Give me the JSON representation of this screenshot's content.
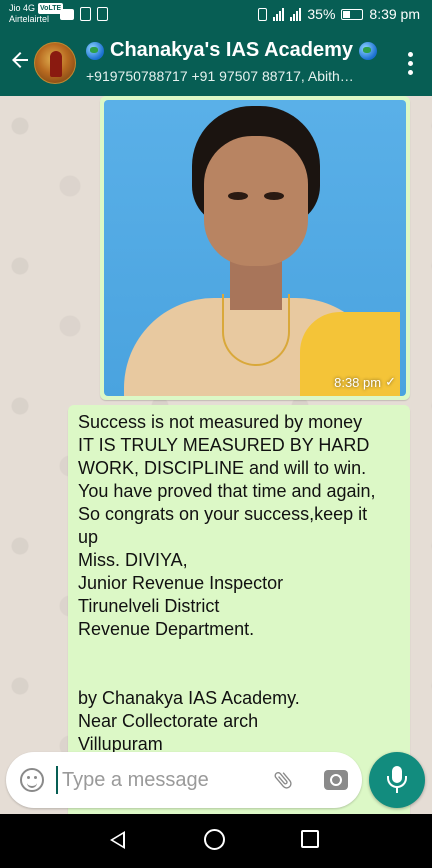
{
  "status_bar": {
    "carrier1": "Jio 4G",
    "volte": "VoLTE",
    "carrier2": "Airtelairtel",
    "battery": "35%",
    "time": "8:39 pm"
  },
  "header": {
    "title": "Chanakya's IAS Academy",
    "subtitle": "+919750788717 +91 97507 88717, Abith…"
  },
  "messages": [
    {
      "type": "image",
      "time": "8:38 pm",
      "status": "✓"
    },
    {
      "type": "text",
      "lines": [
        "Success is not measured by money",
        "IT IS TRULY MEASURED BY HARD",
        "WORK, DISCIPLINE and will to win.",
        "You have proved that time and again,",
        "So congrats on your success,keep it",
        "up",
        "Miss. DIVIYA,",
        "Junior Revenue Inspector",
        "Tirunelveli District",
        "Revenue Department.",
        "",
        "",
        "by Chanakya IAS Academy.",
        "Near Collectorate arch",
        "Villupuram"
      ]
    }
  ],
  "composer": {
    "placeholder": "Type a message"
  },
  "icons": {
    "back": "arrow-left-icon",
    "menu": "more-vert-icon",
    "emoji": "emoji-icon",
    "attach": "paperclip-icon",
    "camera": "camera-icon",
    "mic": "mic-icon"
  },
  "colors": {
    "header": "#075e54",
    "bubble_out": "#dcf8c6",
    "accent": "#128c7e",
    "chat_bg": "#e5ddd5"
  }
}
